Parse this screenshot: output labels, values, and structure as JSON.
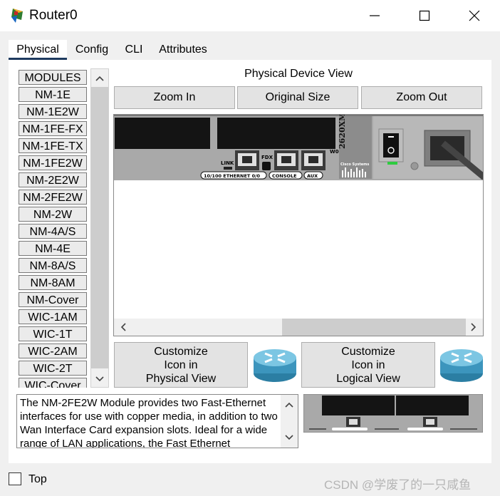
{
  "window": {
    "title": "Router0"
  },
  "tabs": [
    {
      "label": "Physical",
      "active": true
    },
    {
      "label": "Config"
    },
    {
      "label": "CLI"
    },
    {
      "label": "Attributes"
    }
  ],
  "modules": [
    "MODULES",
    "NM-1E",
    "NM-1E2W",
    "NM-1FE-FX",
    "NM-1FE-TX",
    "NM-1FE2W",
    "NM-2E2W",
    "NM-2FE2W",
    "NM-2W",
    "NM-4A/S",
    "NM-4E",
    "NM-8A/S",
    "NM-8AM",
    "NM-Cover",
    "WIC-1AM",
    "WIC-1T",
    "WIC-2AM",
    "WIC-2T",
    "WIC-Cover"
  ],
  "physical_view": {
    "label": "Physical Device View",
    "zoom_in": "Zoom In",
    "original_size": "Original Size",
    "zoom_out": "Zoom Out"
  },
  "device": {
    "model": "2620XM",
    "vendor": "Cisco Systems",
    "port_labels": [
      "LINK",
      "FDX",
      "W0"
    ],
    "bottom_labels": [
      "10/100 ETHERNET 0/0",
      "CONSOLE",
      "AUX"
    ]
  },
  "customize": {
    "physical": [
      "Customize",
      "Icon in",
      "Physical View"
    ],
    "logical": [
      "Customize",
      "Icon in",
      "Logical View"
    ]
  },
  "description": "The NM-2FE2W Module provides two Fast-Ethernet interfaces for use with copper media, in addition to two Wan Interface Card expansion slots. Ideal for a wide range of LAN applications, the Fast Ethernet",
  "footer": {
    "top_label": "Top",
    "top_checked": false,
    "watermark": "CSDN @学废了的一只咸鱼"
  },
  "colors": {
    "tab_underline": "#1e3a5f",
    "router_blue": "#4aa3c8",
    "chassis": "#a9a9a9"
  }
}
